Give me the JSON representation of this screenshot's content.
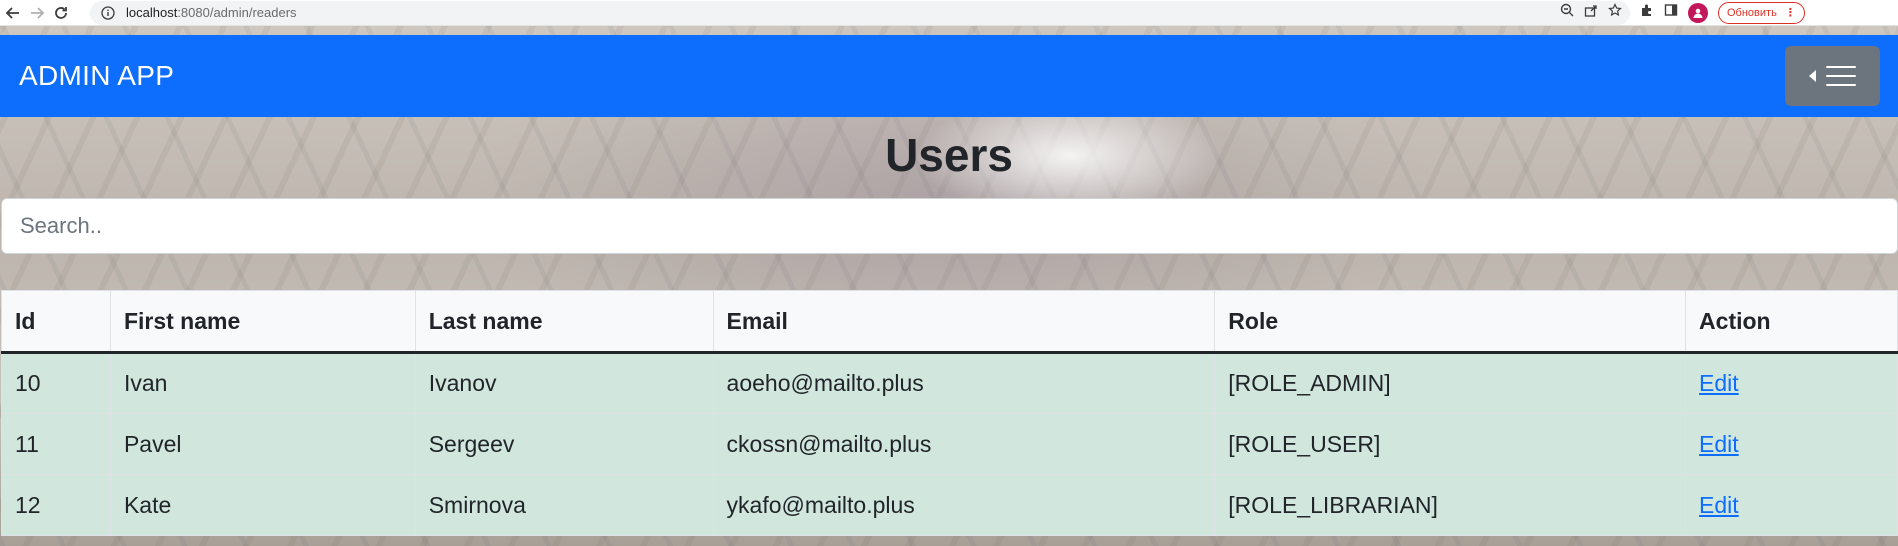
{
  "browser": {
    "url_host": "localhost",
    "url_port_path": ":8080/admin/readers",
    "update_label": "Обновить"
  },
  "navbar": {
    "brand": "ADMIN APP"
  },
  "page": {
    "title": "Users",
    "search_placeholder": "Search.."
  },
  "table": {
    "headers": {
      "id": "Id",
      "first_name": "First name",
      "last_name": "Last name",
      "email": "Email",
      "role": "Role",
      "action": "Action"
    },
    "rows": [
      {
        "id": "10",
        "first_name": "Ivan",
        "last_name": "Ivanov",
        "email": "aoeho@mailto.plus",
        "role": "[ROLE_ADMIN]",
        "action": "Edit"
      },
      {
        "id": "11",
        "first_name": "Pavel",
        "last_name": "Sergeev",
        "email": "ckossn@mailto.plus",
        "role": "[ROLE_USER]",
        "action": "Edit"
      },
      {
        "id": "12",
        "first_name": "Kate",
        "last_name": "Smirnova",
        "email": "ykafo@mailto.plus",
        "role": "[ROLE_LIBRARIAN]",
        "action": "Edit"
      }
    ]
  },
  "colors": {
    "navbar_bg": "#0d6efd",
    "row_success_bg": "#d1e7dd",
    "toggle_bg": "#6c757d",
    "link": "#0d6efd"
  },
  "icons": [
    "back-arrow-icon",
    "forward-arrow-icon",
    "reload-icon",
    "info-icon",
    "zoom-icon",
    "share-icon",
    "star-icon",
    "extensions-icon",
    "side-panel-icon",
    "profile-icon",
    "caret-left-icon",
    "hamburger-icon"
  ]
}
